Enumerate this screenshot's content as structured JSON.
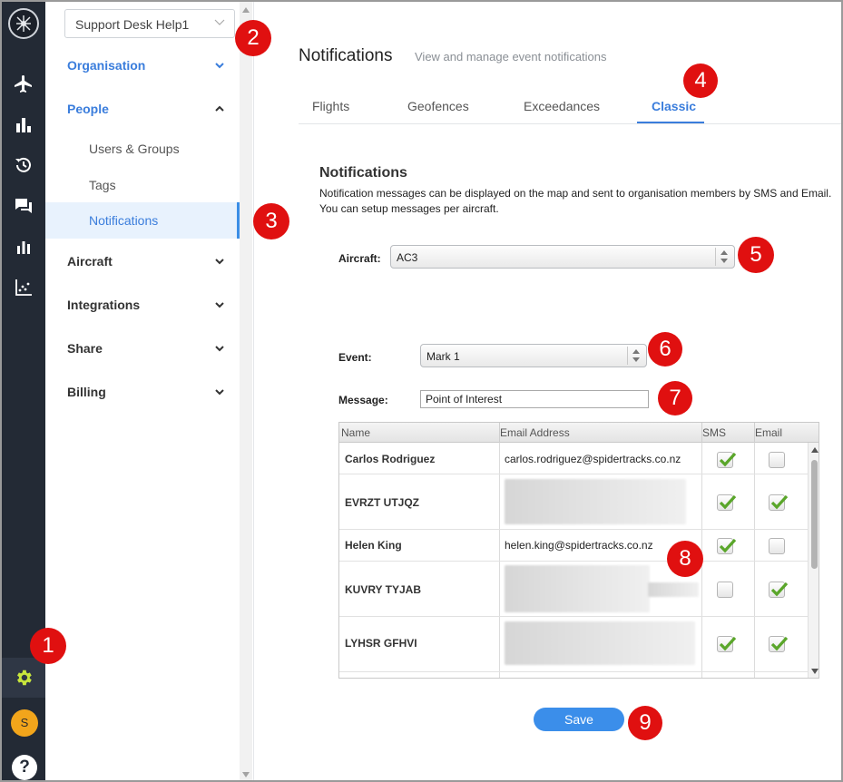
{
  "rail": {
    "items": [
      {
        "icon": "plane-icon"
      },
      {
        "icon": "bar-chart-icon"
      },
      {
        "icon": "history-icon"
      },
      {
        "icon": "chat-icon"
      },
      {
        "icon": "reports-icon"
      },
      {
        "icon": "scatter-chart-icon"
      }
    ],
    "settings_icon": "gear-icon",
    "settings_color": "#c8e63c",
    "avatar_initial": "S",
    "help_label": "?"
  },
  "sidebar": {
    "org_select_value": "Support Desk Help1",
    "sections": [
      {
        "label": "Organisation",
        "active": true
      },
      {
        "label": "People",
        "active": true,
        "expanded": true
      },
      {
        "label": "Aircraft"
      },
      {
        "label": "Integrations"
      },
      {
        "label": "Share"
      },
      {
        "label": "Billing"
      }
    ],
    "people_items": [
      {
        "label": "Users & Groups"
      },
      {
        "label": "Tags"
      },
      {
        "label": "Notifications",
        "selected": true
      }
    ]
  },
  "header": {
    "title": "Notifications",
    "subtitle": "View and manage event notifications"
  },
  "tabs": [
    {
      "label": "Flights"
    },
    {
      "label": "Geofences"
    },
    {
      "label": "Exceedances"
    },
    {
      "label": "Classic",
      "active": true
    }
  ],
  "classic": {
    "title": "Notifications",
    "description_line1": "Notification messages can be displayed on the map and sent to organisation members by SMS and Email.",
    "description_line2": "You can setup messages per aircraft.",
    "aircraft_label": "Aircraft:",
    "aircraft_value": "AC3",
    "event_label": "Event:",
    "event_value": "Mark 1",
    "message_label": "Message:",
    "message_value": "Point of Interest",
    "grid_headers": {
      "name": "Name",
      "email": "Email Address",
      "sms": "SMS",
      "email_col": "Email"
    },
    "recipients": [
      {
        "name": "Carlos Rodriguez",
        "email": "carlos.rodriguez@spidertracks.co.nz",
        "sms": true,
        "email_checked": false
      },
      {
        "name": "EVRZT UTJQZ",
        "email": "",
        "sms": true,
        "email_checked": true
      },
      {
        "name": "Helen King",
        "email": "helen.king@spidertracks.co.nz",
        "sms": true,
        "email_checked": false
      },
      {
        "name": "KUVRY TYJAB",
        "email": "",
        "sms": false,
        "email_checked": true
      },
      {
        "name": "LYHSR GFHVI",
        "email": "",
        "sms": true,
        "email_checked": true
      }
    ],
    "save_label": "Save"
  },
  "markers": [
    "1",
    "2",
    "3",
    "4",
    "5",
    "6",
    "7",
    "8",
    "9"
  ],
  "colors": {
    "rail_bg": "#232a35",
    "accent": "#3a7ddc",
    "save_button": "#3b8eea",
    "marker": "#e01010",
    "check_green": "#5aa62a"
  }
}
